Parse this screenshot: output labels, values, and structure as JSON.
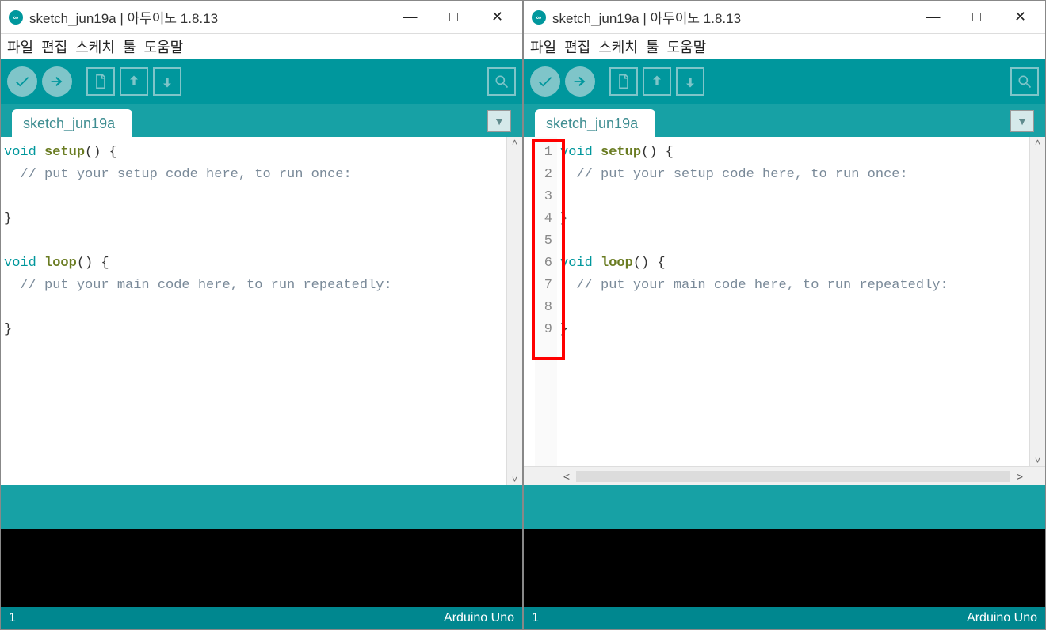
{
  "titlebar": {
    "title": "sketch_jun19a | 아두이노 1.8.13",
    "icon_label": "∞"
  },
  "menubar": [
    "파일",
    "편집",
    "스케치",
    "툴",
    "도움말"
  ],
  "tab": {
    "label": "sketch_jun19a"
  },
  "code_lines": [
    {
      "type": "void",
      "fn": "setup",
      "suffix": "() {"
    },
    {
      "comment": "  // put your setup code here, to run once:"
    },
    {
      "blank": ""
    },
    {
      "text": "}"
    },
    {
      "blank": ""
    },
    {
      "type": "void",
      "fn": "loop",
      "suffix": "() {"
    },
    {
      "comment": "  // put your main code here, to run repeatedly:"
    },
    {
      "blank": ""
    },
    {
      "text": "}"
    }
  ],
  "line_numbers": [
    "1",
    "2",
    "3",
    "4",
    "5",
    "6",
    "7",
    "8",
    "9"
  ],
  "statusbar": {
    "line": "1",
    "board": "Arduino Uno"
  },
  "icons": {
    "verify": "verify-icon",
    "upload": "upload-icon",
    "new": "new-file-icon",
    "open": "open-file-icon",
    "save": "save-file-icon",
    "serial": "serial-monitor-icon"
  }
}
